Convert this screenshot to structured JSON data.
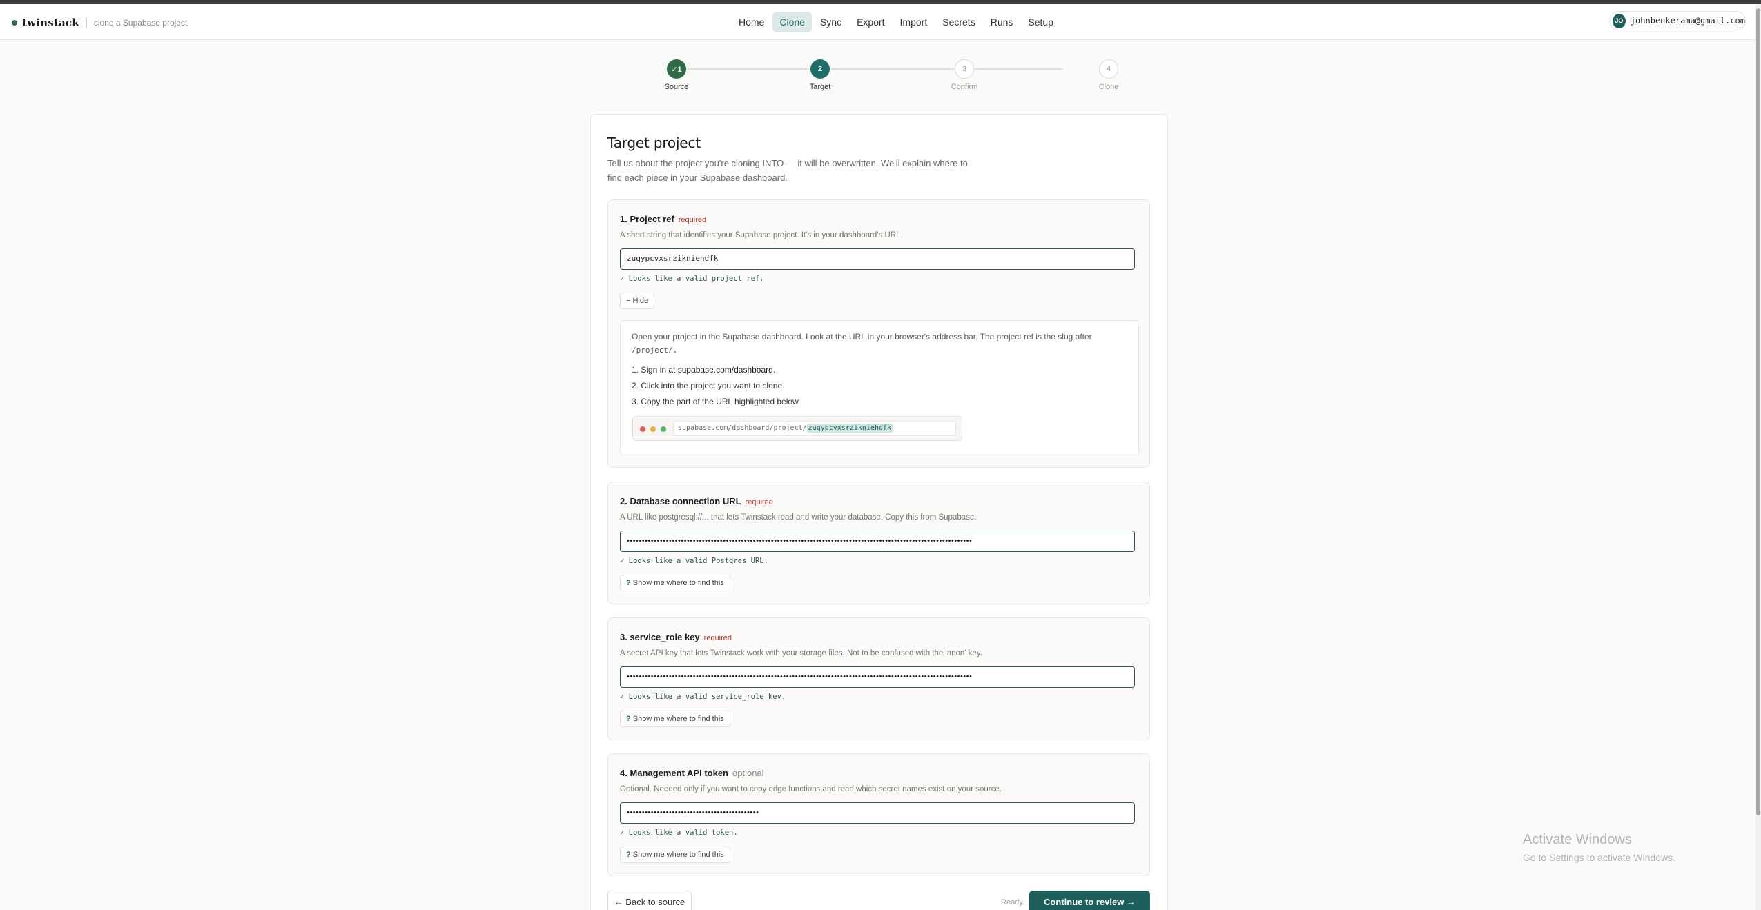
{
  "header": {
    "brand": "twinstack",
    "tagline": "clone a Supabase project",
    "nav": [
      "Home",
      "Clone",
      "Sync",
      "Export",
      "Import",
      "Secrets",
      "Runs",
      "Setup"
    ],
    "active_nav": "Clone",
    "user_initials": "JO",
    "user_email": "johnbenkerama@gmail.com"
  },
  "stepper": {
    "steps": [
      {
        "number": "✓1",
        "label": "Source",
        "state": "done"
      },
      {
        "number": "2",
        "label": "Target",
        "state": "current"
      },
      {
        "number": "3",
        "label": "Confirm",
        "state": "todo"
      },
      {
        "number": "4",
        "label": "Clone",
        "state": "todo"
      }
    ]
  },
  "card": {
    "title": "Target project",
    "description": "Tell us about the project you're cloning INTO — it will be overwritten. We'll explain where to find each piece in your Supabase dashboard."
  },
  "sections": {
    "project_ref": {
      "title": "1. Project ref",
      "badge": "required",
      "description": "A short string that identifies your Supabase project. It's in your dashboard's URL.",
      "value": "zuqypcvxsrzikniehdfk",
      "valid": "✓ Looks like a valid project ref.",
      "toggle": "− Hide",
      "help": {
        "intro_prefix": "Open your project in the Supabase dashboard. Look at the URL in your browser's address bar. The project ref is the slug after",
        "intro_code": "/project/.",
        "step1_prefix": "1. Sign in at ",
        "step1_link": "supabase.com/dashboard",
        "step1_suffix": ".",
        "step2": "2. Click into the project you want to clone.",
        "step3": "3. Copy the part of the URL highlighted below.",
        "url_prefix": "supabase.com/dashboard/project/",
        "url_highlight": "zuqypcvxsrzikniehdfk"
      }
    },
    "db_url": {
      "title": "2. Database connection URL",
      "badge": "required",
      "description": "A URL like postgresql://... that lets Twinstack read and write your database. Copy this from Supabase.",
      "value": "•••••••••••••••••••••••••••••••••••••••••••••••••••••••••••••••••••••••••••••••••••••••••••••••••••••••••••••••••••",
      "valid": "✓ Looks like a valid Postgres URL.",
      "help_button_icon": "?",
      "help_button": "Show me where to find this"
    },
    "service_role": {
      "title": "3. service_role key",
      "badge": "required",
      "description": "A secret API key that lets Twinstack work with your storage files. Not to be confused with the 'anon' key.",
      "value": "•••••••••••••••••••••••••••••••••••••••••••••••••••••••••••••••••••••••••••••••••••••••••••••••••••••••••••••••••••",
      "valid": "✓ Looks like a valid service_role key.",
      "help_button_icon": "?",
      "help_button": "Show me where to find this"
    },
    "mgmt_token": {
      "title": "4. Management API token",
      "badge": "optional",
      "description": "Optional. Needed only if you want to copy edge functions and read which secret names exist on your source.",
      "value": "••••••••••••••••••••••••••••••••••••••••••••",
      "valid": "✓ Looks like a valid token.",
      "help_button_icon": "?",
      "help_button": "Show me where to find this"
    }
  },
  "footer": {
    "back": "← Back to source",
    "status": "Ready.",
    "continue": "Continue to review →"
  },
  "watermark": {
    "title": "Activate Windows",
    "subtitle": "Go to Settings to activate Windows."
  }
}
